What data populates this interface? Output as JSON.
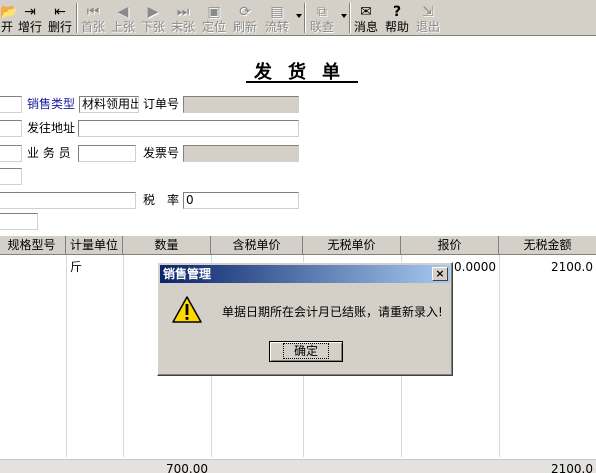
{
  "toolbar": {
    "items": [
      {
        "label": "开",
        "icon": "open-icon",
        "glyph": "📂",
        "enabled": true
      },
      {
        "label": "增行",
        "icon": "add-row-icon",
        "glyph": "⇥",
        "enabled": true
      },
      {
        "label": "删行",
        "icon": "delete-row-icon",
        "glyph": "⇤",
        "enabled": true
      },
      {
        "label": "首张",
        "icon": "first-record-icon",
        "glyph": "⏮",
        "enabled": false
      },
      {
        "label": "上张",
        "icon": "previous-record-icon",
        "glyph": "◀",
        "enabled": false
      },
      {
        "label": "下张",
        "icon": "next-record-icon",
        "glyph": "▶",
        "enabled": false
      },
      {
        "label": "末张",
        "icon": "last-record-icon",
        "glyph": "⏭",
        "enabled": false
      },
      {
        "label": "定位",
        "icon": "locate-icon",
        "glyph": "▣",
        "enabled": false
      },
      {
        "label": "刷新",
        "icon": "refresh-icon",
        "glyph": "⟳",
        "enabled": false
      },
      {
        "label": "流转",
        "icon": "workflow-icon",
        "glyph": "▤",
        "enabled": false
      },
      {
        "label": "联查",
        "icon": "link-query-icon",
        "glyph": "⧉",
        "enabled": false
      },
      {
        "label": "消息",
        "icon": "message-icon",
        "glyph": "✉",
        "enabled": true
      },
      {
        "label": "帮助",
        "icon": "help-icon",
        "glyph": "?",
        "enabled": true
      },
      {
        "label": "退出",
        "icon": "exit-icon",
        "glyph": "⇲",
        "enabled": false
      }
    ]
  },
  "form": {
    "title": "发货单",
    "sales_type_label": "销售类型",
    "sales_type_value": "材料领用出",
    "order_no_label": "订单号",
    "ship_address_label": "发往地址",
    "salesman_label": "业 务 员",
    "invoice_no_label": "发票号",
    "tax_rate_label": "税　率",
    "tax_rate_value": "0"
  },
  "grid": {
    "headers": [
      "规格型号",
      "计量单位",
      "数量",
      "含税单价",
      "无税单价",
      "报价",
      "无税金额"
    ],
    "row1": {
      "unit": "斤",
      "quote": "0.0000",
      "amount": "2100.0"
    },
    "footer": {
      "quantity_total": "700.00",
      "amount_total": "2100.0"
    }
  },
  "dialog": {
    "title": "销售管理",
    "close_glyph": "×",
    "message": "单据日期所在会计月已结账，请重新录入!",
    "ok_label": "确定"
  },
  "colors": {
    "title_bar_start": "#0a246a",
    "title_bar_end": "#a6caf0",
    "chrome": "#d4d0c8",
    "label_blue": "#1a1aa0",
    "warning_yellow": "#ffd800"
  }
}
